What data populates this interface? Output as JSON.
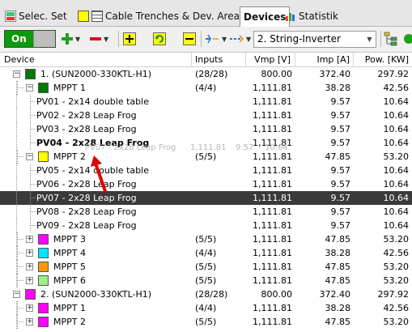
{
  "tabs": [
    {
      "label": "Selec. Set",
      "icon": "selection-set-icon",
      "active": false
    },
    {
      "label": "Cable Trenches & Dev. Areas",
      "icon": "cable-trench-icon",
      "active": false
    },
    {
      "label": "Devices",
      "icon": "",
      "active": true
    },
    {
      "label": "Statistik",
      "icon": "statistics-icon",
      "active": false
    }
  ],
  "toolbar": {
    "on_label": "On",
    "inverter_type": "2. String-Inverter"
  },
  "columns": {
    "device": "Device",
    "inputs": "Inputs",
    "vmp": "Vmp [V]",
    "imp": "Imp [A]",
    "pow": "Pow. [KW]"
  },
  "rows": [
    {
      "label": "1.  (SUN2000-330KTL-H1)",
      "inputs": "(28/28)",
      "vmp": "800.00",
      "imp": "372.40",
      "pow": "297.92",
      "color": "#007a00"
    },
    {
      "label": "MPPT  1",
      "inputs": "(4/4)",
      "vmp": "1,111.81",
      "imp": "38.28",
      "pow": "42.56",
      "color": "#007a00"
    },
    {
      "label": "PV01 - 2x14 double table",
      "inputs": "",
      "vmp": "1,111.81",
      "imp": "9.57",
      "pow": "10.64"
    },
    {
      "label": "PV02 - 2x28 Leap Frog",
      "inputs": "",
      "vmp": "1,111.81",
      "imp": "9.57",
      "pow": "10.64"
    },
    {
      "label": "PV03 - 2x28 Leap Frog",
      "inputs": "",
      "vmp": "1,111.81",
      "imp": "9.57",
      "pow": "10.64"
    },
    {
      "label": "PV04 - 2x28 Leap Frog",
      "inputs": "",
      "vmp": "1,111.81",
      "imp": "9.57",
      "pow": "10.64",
      "bold": true
    },
    {
      "label": "MPPT  2",
      "inputs": "(5/5)",
      "vmp": "1,111.81",
      "imp": "47.85",
      "pow": "53.20",
      "color": "#ffff00"
    },
    {
      "label": "PV05 - 2x14 double table",
      "inputs": "",
      "vmp": "1,111.81",
      "imp": "9.57",
      "pow": "10.64"
    },
    {
      "label": "PV06 - 2x28 Leap Frog",
      "inputs": "",
      "vmp": "1,111.81",
      "imp": "9.57",
      "pow": "10.64"
    },
    {
      "label": "PV07 - 2x28 Leap Frog",
      "inputs": "",
      "vmp": "1,111.81",
      "imp": "9.57",
      "pow": "10.64",
      "selected": true
    },
    {
      "label": "PV08 - 2x28 Leap Frog",
      "inputs": "",
      "vmp": "1,111.81",
      "imp": "9.57",
      "pow": "10.64"
    },
    {
      "label": "PV09 - 2x28 Leap Frog",
      "inputs": "",
      "vmp": "1,111.81",
      "imp": "9.57",
      "pow": "10.64"
    },
    {
      "label": "MPPT  3",
      "inputs": "(5/5)",
      "vmp": "1,111.81",
      "imp": "47.85",
      "pow": "53.20",
      "color": "#ff00ff"
    },
    {
      "label": "MPPT  4",
      "inputs": "(4/4)",
      "vmp": "1,111.81",
      "imp": "38.28",
      "pow": "42.56",
      "color": "#00e5ff"
    },
    {
      "label": "MPPT  5",
      "inputs": "(5/5)",
      "vmp": "1,111.81",
      "imp": "47.85",
      "pow": "53.20",
      "color": "#ff9900"
    },
    {
      "label": "MPPT  6",
      "inputs": "(5/5)",
      "vmp": "1,111.81",
      "imp": "47.85",
      "pow": "53.20",
      "color": "#99ee88"
    },
    {
      "label": "2.  (SUN2000-330KTL-H1)",
      "inputs": "(28/28)",
      "vmp": "800.00",
      "imp": "372.40",
      "pow": "297.92",
      "color": "#ff00ff"
    },
    {
      "label": "MPPT  1",
      "inputs": "(4/4)",
      "vmp": "1,111.81",
      "imp": "38.28",
      "pow": "42.56",
      "color": "#ff00ff"
    },
    {
      "label": "MPPT  2",
      "inputs": "(5/5)",
      "vmp": "1,111.81",
      "imp": "47.85",
      "pow": "53.20",
      "color": "#ff00ff"
    }
  ],
  "drag_ghost": {
    "label": "PV07 - 2x28 Leap Frog",
    "vmp": "1,111.81",
    "imp": "9.57",
    "pow": "10.64"
  }
}
